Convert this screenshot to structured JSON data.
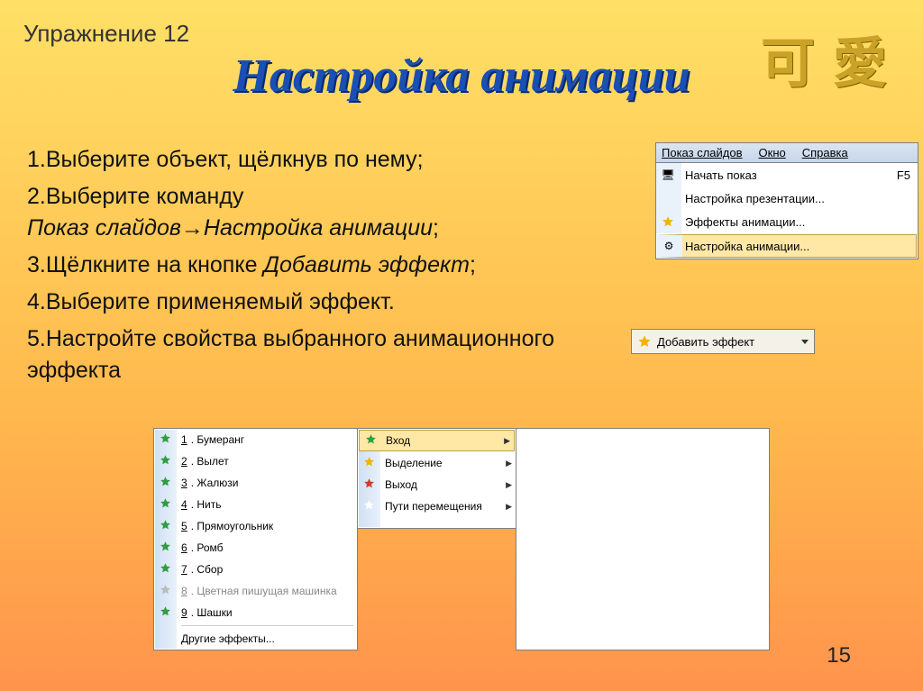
{
  "exercise_label": "Упражнение 12",
  "title": "Настройка анимации",
  "deco": {
    "char1": "可",
    "char2": "愛"
  },
  "steps": {
    "s1": "1.Выберите объект, щёлкнув по нему;",
    "s2a": "2.Выберите команду",
    "s2b": "Показ слайдов→Настройка анимации",
    "s2c": ";",
    "s3a": "3.Щёлкните на кнопке ",
    "s3b": "Добавить эффект",
    "s3c": ";",
    "s4": "4.Выберите применяемый эффект.",
    "s5": "5.Настройте свойства выбранного анимационного эффекта"
  },
  "menu_bar": {
    "item1": "Показ слайдов",
    "item2": "Окно",
    "item3": "Справка"
  },
  "app_menu": {
    "row1_label": "Начать показ",
    "row1_shortcut": "F5",
    "row2_label": "Настройка презентации...",
    "row3_label": "Эффекты анимации...",
    "row4_label": "Настройка анимации..."
  },
  "add_effect_button": "Добавить эффект",
  "effects_left": {
    "i1": "Бумеранг",
    "i2": "Вылет",
    "i3": "Жалюзи",
    "i4": "Нить",
    "i5": "Прямоугольник",
    "i6": "Ромб",
    "i7": "Сбор",
    "i8": "Цветная пишущая машинка",
    "i9": "Шашки",
    "other": "Другие эффекты..."
  },
  "nums": {
    "n1": "1",
    "n2": "2",
    "n3": "3",
    "n4": "4",
    "n5": "5",
    "n6": "6",
    "n7": "7",
    "n8": "8",
    "n9": "9"
  },
  "dot": ".",
  "effects_right": {
    "r1": "Вход",
    "r2": "Выделение",
    "r3": "Выход",
    "r4": "Пути перемещения"
  },
  "page_number": "15",
  "icons": {
    "monitor": "🖥",
    "star_green": "★",
    "star_yellow": "★",
    "star_red": "★",
    "path": "☆",
    "gears": "⚙"
  },
  "star_colors": {
    "green": "#2e9e3f",
    "yellow": "#f0b400",
    "red": "#d23c2a",
    "white": "#ffffff"
  }
}
